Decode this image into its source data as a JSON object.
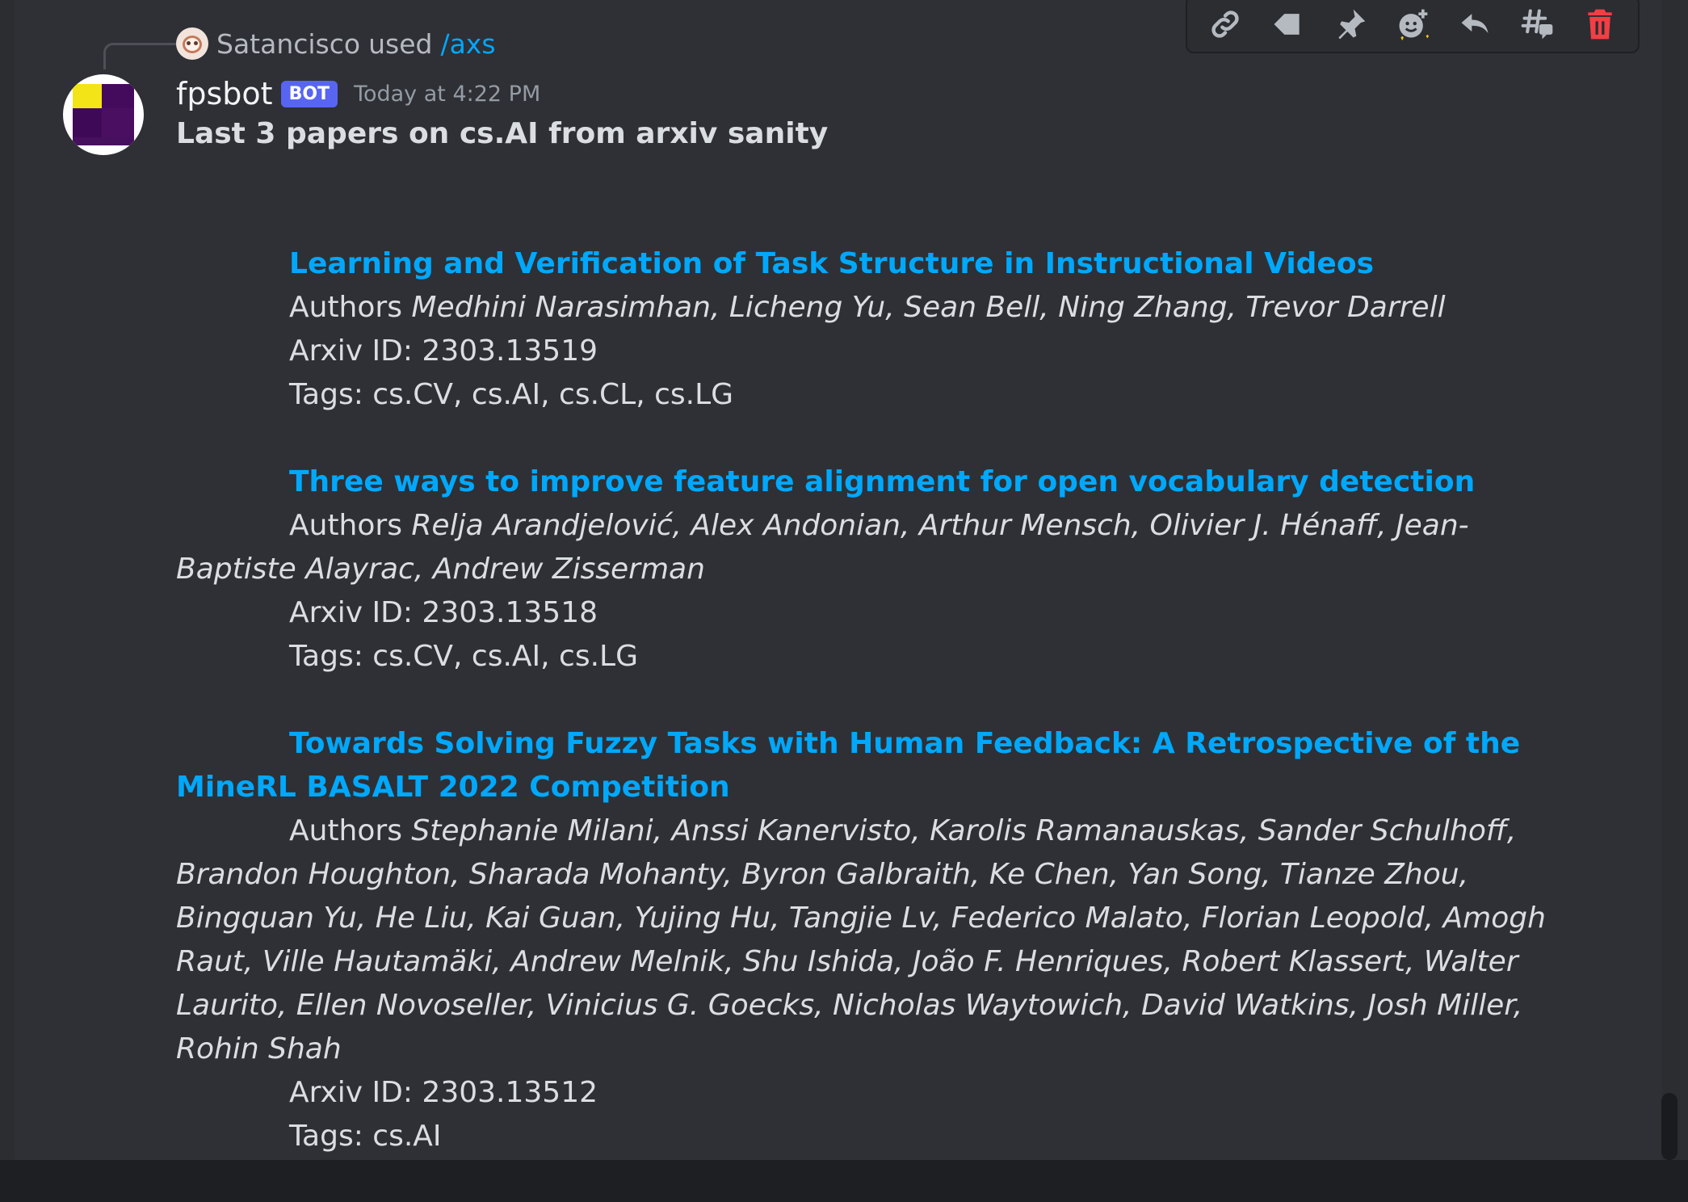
{
  "interaction": {
    "user": "Satancisco",
    "used_text": "used",
    "command": "/axs"
  },
  "message": {
    "username": "fpsbot",
    "badge": "BOT",
    "timestamp": "Today at 4:22 PM",
    "headline": "Last 3 papers on cs.AI from arxiv sanity"
  },
  "papers": [
    {
      "title": "Learning and Verification of Task Structure in Instructional Videos",
      "authors_label": "Authors",
      "authors": "Medhini Narasimhan, Licheng Yu, Sean Bell, Ning Zhang, Trevor Darrell",
      "arxiv": "Arxiv ID: 2303.13519",
      "tags": "Tags: cs.CV, cs.AI, cs.CL, cs.LG"
    },
    {
      "title": "Three ways to improve feature alignment for open vocabulary detection",
      "authors_label": "Authors",
      "authors": "Relja Arandjelović, Alex Andonian, Arthur Mensch, Olivier J. Hénaff, Jean-Baptiste Alayrac, Andrew Zisserman",
      "arxiv": "Arxiv ID: 2303.13518",
      "tags": "Tags: cs.CV, cs.AI, cs.LG"
    },
    {
      "title": "Towards Solving Fuzzy Tasks with Human Feedback: A Retrospective of the MineRL BASALT 2022 Competition",
      "authors_label": "Authors",
      "authors": "Stephanie Milani, Anssi Kanervisto, Karolis Ramanauskas, Sander Schulhoff, Brandon Houghton, Sharada Mohanty, Byron Galbraith, Ke Chen, Yan Song, Tianze Zhou, Bingquan Yu, He Liu, Kai Guan, Yujing Hu, Tangjie Lv, Federico Malato, Florian Leopold, Amogh Raut, Ville Hautamäki, Andrew Melnik, Shu Ishida, João F. Henriques, Robert Klassert, Walter Laurito, Ellen Novoseller, Vinicius G. Goecks, Nicholas Waytowich, David Watkins, Josh Miller, Rohin Shah",
      "arxiv": "Arxiv ID: 2303.13512",
      "tags": "Tags: cs.AI"
    }
  ],
  "toolbar": {
    "icons": [
      "link-icon",
      "tag-icon",
      "pin-icon",
      "add-reaction-icon",
      "reply-icon",
      "create-thread-icon",
      "delete-icon"
    ],
    "colors": {
      "default": "#b5bac1",
      "danger": "#f23f43"
    }
  },
  "colors": {
    "link": "#00a8fc",
    "badge": "#5865f2",
    "background": "#2e3035",
    "text": "#dbdee1",
    "muted": "#949ba4"
  }
}
